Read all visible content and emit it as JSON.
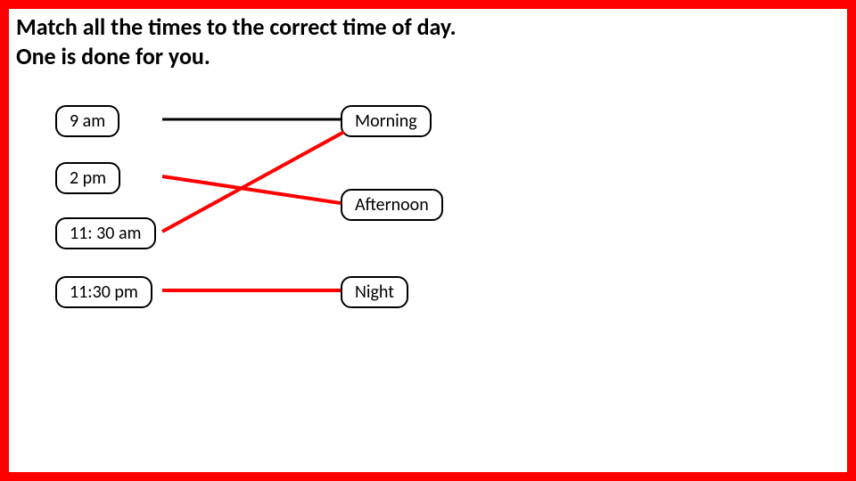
{
  "instructions": {
    "line1": "Match all the times to the correct time of day.",
    "line2": "One is done for you."
  },
  "left_chips": [
    {
      "id": "t-9am",
      "label": "9 am"
    },
    {
      "id": "t-2pm",
      "label": "2 pm"
    },
    {
      "id": "t-1130am",
      "label": "11: 30 am"
    },
    {
      "id": "t-1130pm",
      "label": "11:30 pm"
    }
  ],
  "right_chips": [
    {
      "id": "p-morning",
      "label": "Morning"
    },
    {
      "id": "p-afternoon",
      "label": "Afternoon"
    },
    {
      "id": "p-night",
      "label": "Night"
    }
  ],
  "connections": [
    {
      "from": "t-9am",
      "to": "p-morning",
      "color": "#000000",
      "role": "example"
    },
    {
      "from": "t-2pm",
      "to": "p-afternoon",
      "color": "#ff0000",
      "role": "answer"
    },
    {
      "from": "t-1130am",
      "to": "p-morning",
      "color": "#ff0000",
      "role": "answer"
    },
    {
      "from": "t-1130pm",
      "to": "p-night",
      "color": "#ff0000",
      "role": "answer"
    }
  ],
  "colors": {
    "frame_border": "#ff0000",
    "connection_answer": "#ff0000",
    "connection_example": "#000000"
  },
  "chart_data": {
    "type": "table",
    "title": "Match times to time of day",
    "categories": [
      "9 am",
      "2 pm",
      "11:30 am",
      "11:30 pm"
    ],
    "series": [
      {
        "name": "time_of_day",
        "values": [
          "Morning",
          "Afternoon",
          "Morning",
          "Night"
        ]
      }
    ]
  }
}
